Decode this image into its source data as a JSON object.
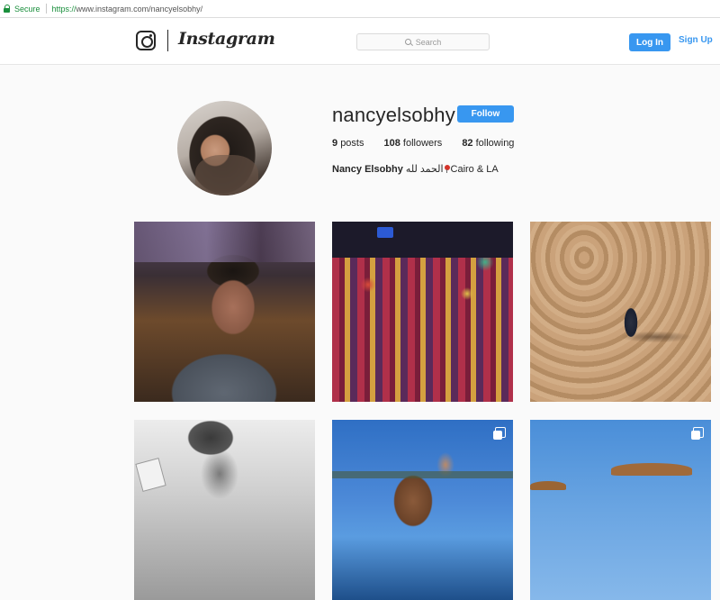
{
  "browser": {
    "secure_label": "Secure",
    "url_proto": "https://",
    "url_rest": "www.instagram.com/nancyelsobhy/"
  },
  "header": {
    "wordmark": "Instagram",
    "search_placeholder": "Search",
    "login_label": "Log In",
    "signup_label": "Sign Up"
  },
  "profile": {
    "username": "nancyelsobhy",
    "follow_label": "Follow",
    "stats": {
      "posts_count": "9",
      "posts_label": "posts",
      "followers_count": "108",
      "followers_label": "followers",
      "following_count": "82",
      "following_label": "following"
    },
    "bio": {
      "name": "Nancy Elsobhy",
      "arabic": "الحمد لله",
      "location": "Cairo & LA"
    }
  },
  "posts": [
    {
      "description": "portrait-young-man-restaurant",
      "multi": false
    },
    {
      "description": "lantern-market",
      "multi": false
    },
    {
      "description": "person-sitting-on-sand-dunes",
      "multi": false
    },
    {
      "description": "bw-person-with-turban",
      "multi": false
    },
    {
      "description": "woman-riding-horse-beach",
      "multi": true
    },
    {
      "description": "beach-umbrellas-blue-sky",
      "multi": true
    }
  ],
  "colors": {
    "accent": "#3897f0",
    "secure_green": "#1a8f3c",
    "background": "#fafafa"
  }
}
